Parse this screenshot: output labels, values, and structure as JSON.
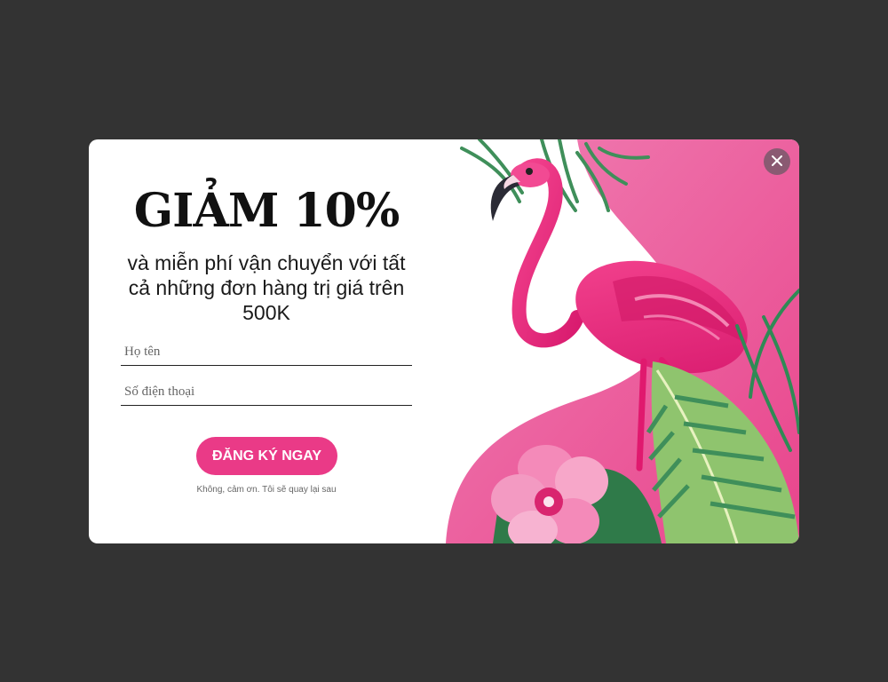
{
  "popup": {
    "headline": "GIẢM 10%",
    "subtitle": "và miễn phí vận chuyển với tất cả những đơn hàng trị giá trên 500K",
    "name_field": {
      "placeholder": "Họ tên",
      "value": ""
    },
    "phone_field": {
      "placeholder": "Số điện thoại",
      "value": ""
    },
    "submit_label": "ĐĂNG KÝ NGAY",
    "decline_label": "Không, cảm ơn. Tôi sẽ quay lại sau",
    "close_icon": "close-icon",
    "illustration": "flamingo-tropical-illustration"
  },
  "colors": {
    "backdrop": "#333333",
    "modal_background": "#ffffff",
    "accent": "#ea3a87",
    "art_pink": "#ec4f95",
    "flamingo": "#f0237f",
    "leaf_green": "#5aa36a",
    "close_button": "#8a5a72"
  }
}
